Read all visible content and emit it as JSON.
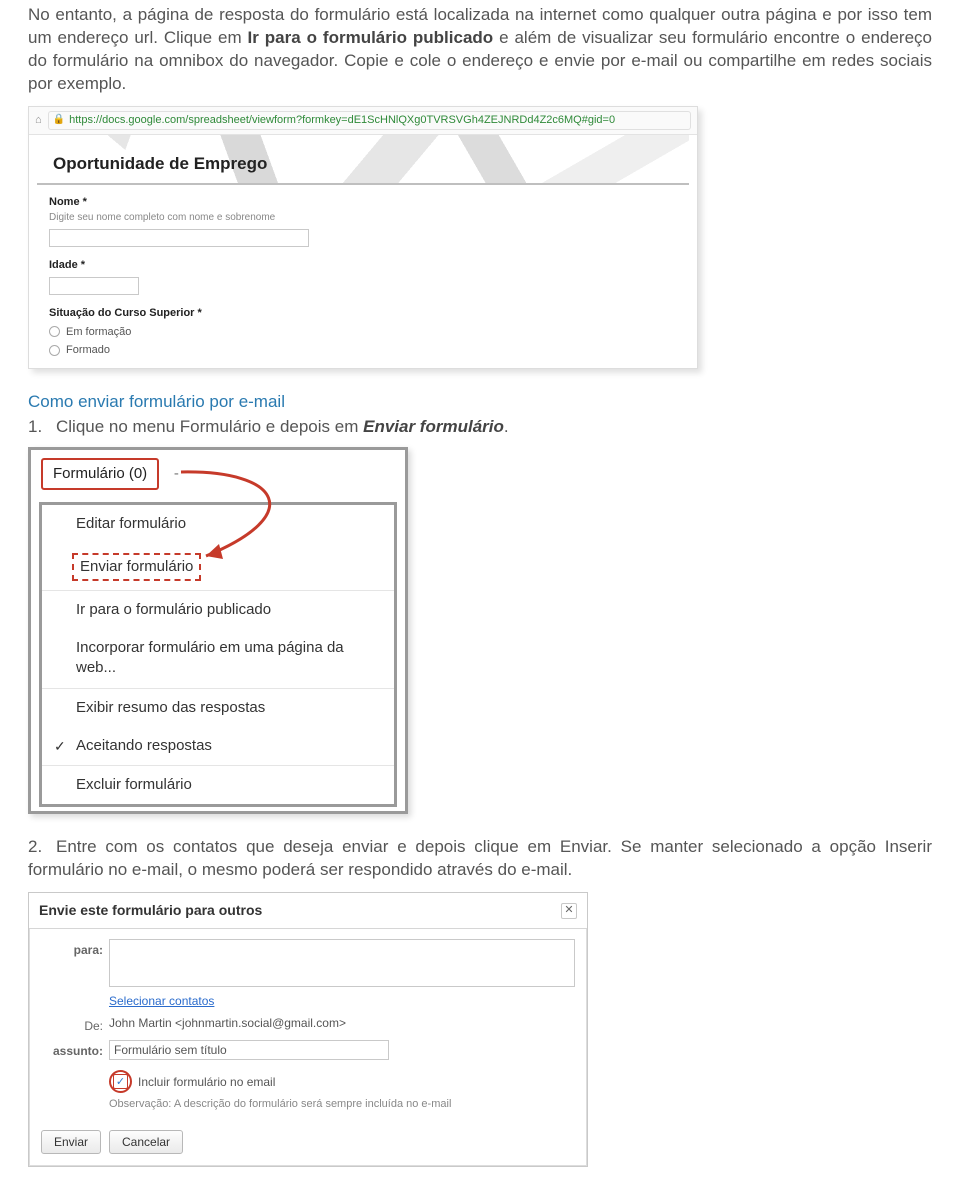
{
  "para1_a": "No entanto, a página de resposta do formulário está localizada na internet como qualquer outra página e por isso tem um endereço url. Clique em ",
  "para1_bold": "Ir para o formulário publicado",
  "para1_b": " e além de visualizar seu formulário encontre o endereço do formulário na omnibox do navegador. Copie e cole o endereço e envie por e-mail ou compartilhe em redes sociais por exemplo.",
  "shot1": {
    "url": "https://docs.google.com/spreadsheet/viewform?formkey=dE1ScHNlQXg0TVRSVGh4ZEJNRDd4Z2c6MQ#gid=0",
    "form_title": "Oportunidade de Emprego",
    "nome_label": "Nome *",
    "nome_hint": "Digite seu nome completo com nome e sobrenome",
    "idade_label": "Idade *",
    "situacao_label": "Situação do Curso Superior *",
    "opt1": "Em formação",
    "opt2": "Formado"
  },
  "heading_blue": "Como enviar formulário por e-mail",
  "step1_num": "1.",
  "step1_a": "Clique no menu Formulário e depois em ",
  "step1_bi": "Enviar formulário",
  "step1_b": ".",
  "shot2": {
    "menu_button": "Formulário (0)",
    "tail": "-",
    "items": [
      "Editar formulário",
      "Enviar formulário",
      "Ir para o formulário publicado",
      "Incorporar formulário em uma página da web...",
      "Exibir resumo das respostas",
      "Aceitando respostas",
      "Excluir formulário"
    ]
  },
  "step2_num": "2.",
  "step2_text": "Entre com os contatos que deseja enviar e depois clique em Enviar. Se manter selecionado a opção Inserir formulário no e-mail, o mesmo poderá ser respondido através do e-mail.",
  "shot3": {
    "title": "Envie este formulário para outros",
    "para_lab": "para:",
    "select_contacts": "Selecionar contatos",
    "de_lab": "De:",
    "de_val": "John Martin <johnmartin.social@gmail.com>",
    "assunto_lab": "assunto:",
    "assunto_val": "Formulário sem título",
    "incluir": "Incluir formulário no email",
    "obs": "Observação: A descrição do formulário será sempre incluída no e-mail",
    "enviar": "Enviar",
    "cancelar": "Cancelar"
  }
}
